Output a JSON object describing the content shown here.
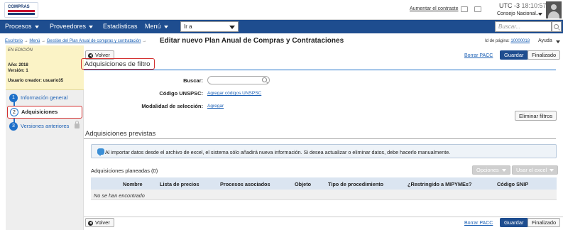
{
  "header": {
    "logo_text": "COMPRAS",
    "contrast_link": "Aumentar el contraste",
    "utc_label": "UTC -3",
    "time": "18:10:57",
    "org": "Consejo Nacional..."
  },
  "nav": {
    "items": [
      "Procesos",
      "Proveedores",
      "Estadísticas",
      "Menú"
    ],
    "goto_value": "Ir a",
    "search_placeholder": "Buscar..."
  },
  "breadcrumb": {
    "items": [
      "Escritorio",
      "Menú",
      "Gestión del Plan Anual de compras y contratación"
    ],
    "title": "Editar nuevo Plan Anual de Compras y Contrataciones"
  },
  "page_meta": {
    "id_label": "Id de página:",
    "id_value": "10000018",
    "help": "Ayuda"
  },
  "sidebar": {
    "status": "EN EDICIÓN",
    "year": "Año: 2018",
    "version": "Versión: 1",
    "creator": "Usuario creador: usuario35",
    "steps": [
      {
        "num": "1",
        "label": "Información general"
      },
      {
        "num": "2",
        "label": "Adquisiciones"
      },
      {
        "num": "3",
        "label": "Versiones anteriores"
      }
    ]
  },
  "toolbar": {
    "back": "Volver",
    "delete_pacc": "Borrar PACC",
    "save": "Guardar",
    "finish": "Finalizado"
  },
  "filters": {
    "title": "Adquisiciones de filtro",
    "search_label": "Buscar:",
    "search_value": "",
    "unspsc_label": "Código UNSPSC:",
    "unspsc_link": "Agregar códigos UNSPSC",
    "modality_label": "Modalidad de selección:",
    "modality_link": "Agregar",
    "clear_button": "Eliminar filtros"
  },
  "planned": {
    "title": "Adquisiciones previstas",
    "info": "Al importar datos desde el archivo de excel, el sistema sólo añadirá nueva información. Si desea actualizar o eliminar datos, debe hacerlo manualmente.",
    "count_label": "Adquisiciones planeadas (0)",
    "options_button": "Opciones",
    "excel_button": "Usar el excel",
    "columns": [
      "Nombre",
      "Lista de precios",
      "Procesos asociados",
      "Objeto",
      "Tipo de procedimiento",
      "¿Restringido a MIPYMEs?",
      "Código SNIP"
    ],
    "empty": "No se han encontrado"
  },
  "colors": {
    "nav": "#1e4d8f",
    "accent": "#1e70c9",
    "highlight": "#d32f2f",
    "status_bg": "#fbf3c6"
  }
}
